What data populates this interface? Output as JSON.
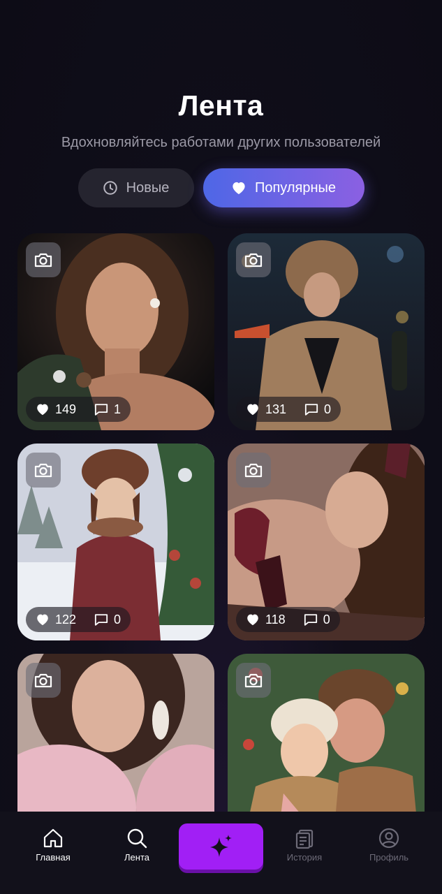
{
  "header": {
    "title": "Лента",
    "subtitle": "Вдохновляйтесь работами других пользователей"
  },
  "tabs": [
    {
      "label": "Новые",
      "icon": "clock-icon",
      "active": false
    },
    {
      "label": "Популярные",
      "icon": "heart-icon",
      "active": true
    }
  ],
  "feed": [
    {
      "likes": "149",
      "comments": "1",
      "image": "woman-winter-portrait"
    },
    {
      "likes": "131",
      "comments": "0",
      "image": "woman-fur-coat-night"
    },
    {
      "likes": "122",
      "comments": "0",
      "image": "illustrated-girl-winter"
    },
    {
      "likes": "118",
      "comments": "0",
      "image": "woman-curly-hair-gloves"
    },
    {
      "image": "woman-pink-feathers"
    },
    {
      "image": "illustrated-couple-christmas"
    }
  ],
  "nav": {
    "home": "Главная",
    "feed": "Лента",
    "history": "История",
    "profile": "Профиль",
    "center_icon": "sparkle-icon"
  },
  "colors": {
    "accent_gradient_start": "#4e67e6",
    "accent_gradient_end": "#8b60e2",
    "create_button": "#a11ff5",
    "background": "#0e0d17"
  }
}
